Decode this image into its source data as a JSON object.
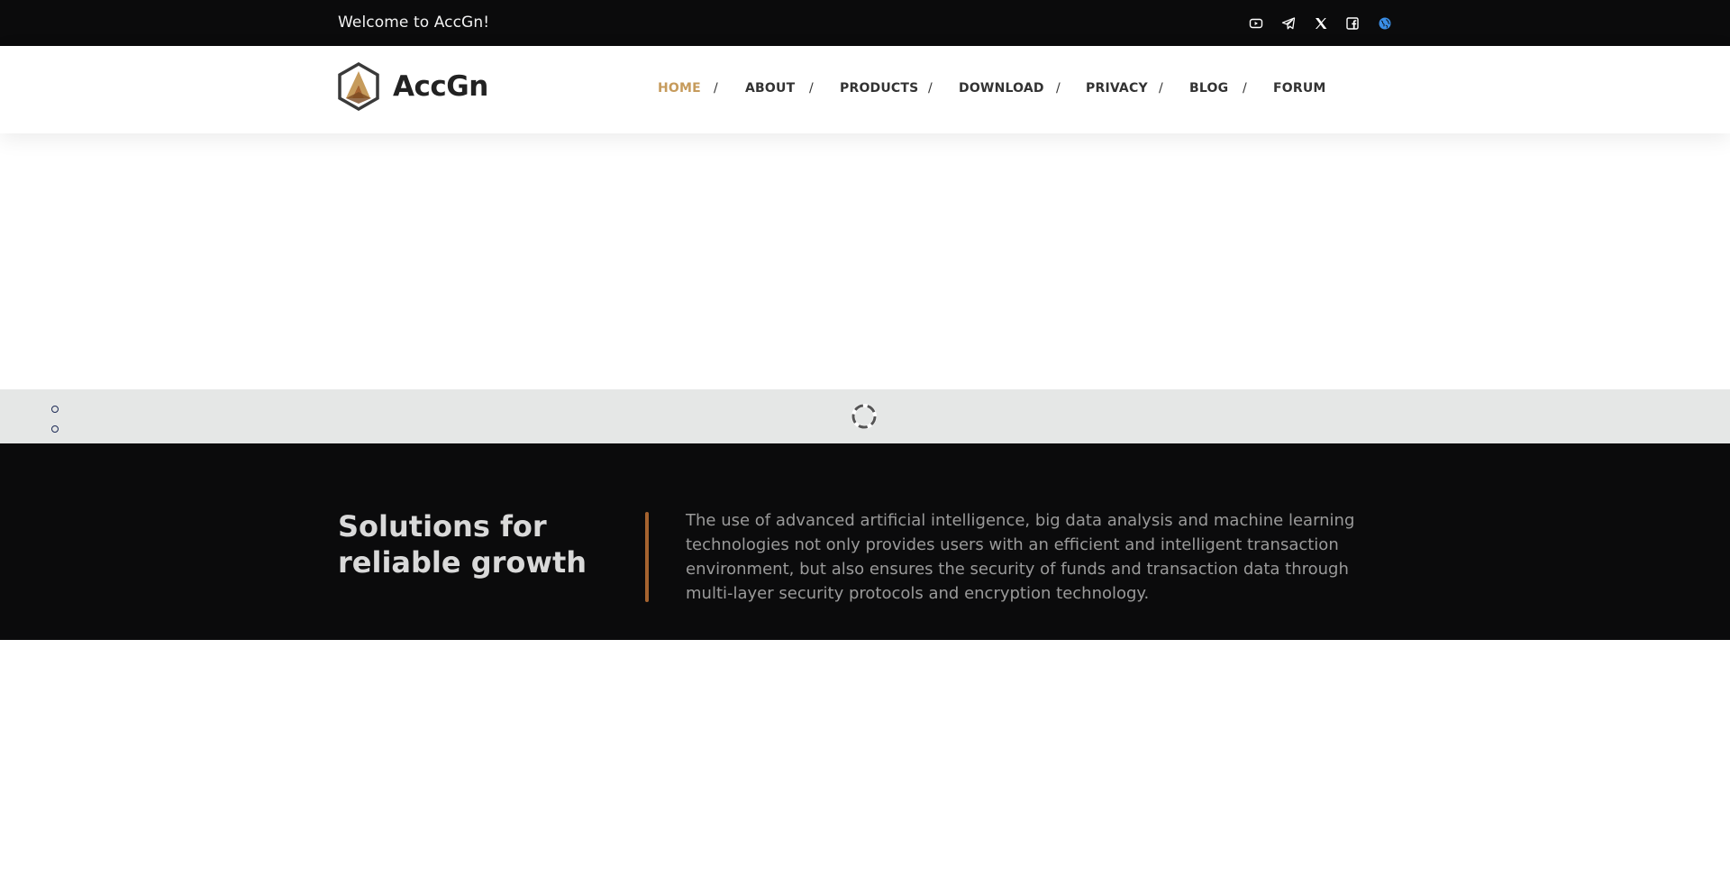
{
  "topbar": {
    "welcome": "Welcome to AccGn!",
    "social_icons": [
      "youtube-icon",
      "telegram-icon",
      "x-icon",
      "facebook-icon",
      "globe-icon"
    ]
  },
  "header": {
    "logo_text": "AccGn",
    "nav": [
      {
        "label": "HOME",
        "active": true
      },
      {
        "label": "ABOUT",
        "active": false
      },
      {
        "label": "PRODUCTS",
        "active": false
      },
      {
        "label": "DOWNLOAD",
        "active": false
      },
      {
        "label": "PRIVACY",
        "active": false
      },
      {
        "label": "BLOG",
        "active": false
      },
      {
        "label": "FORUM",
        "active": false
      }
    ],
    "separator": "/"
  },
  "hero": {
    "title": "Solutions for reliable growth",
    "description": "The use of advanced artificial intelligence, big data analysis and machine learning technologies not only provides users with an efficient and intelligent transaction environment, but also ensures the security of funds and transaction data through multi-layer security protocols and encryption technology."
  },
  "colors": {
    "topbar_bg": "#0b0b0c",
    "nav_active": "#c69b5c",
    "accent_divider": "#a5632f",
    "loader_band": "#e5e7e6"
  }
}
